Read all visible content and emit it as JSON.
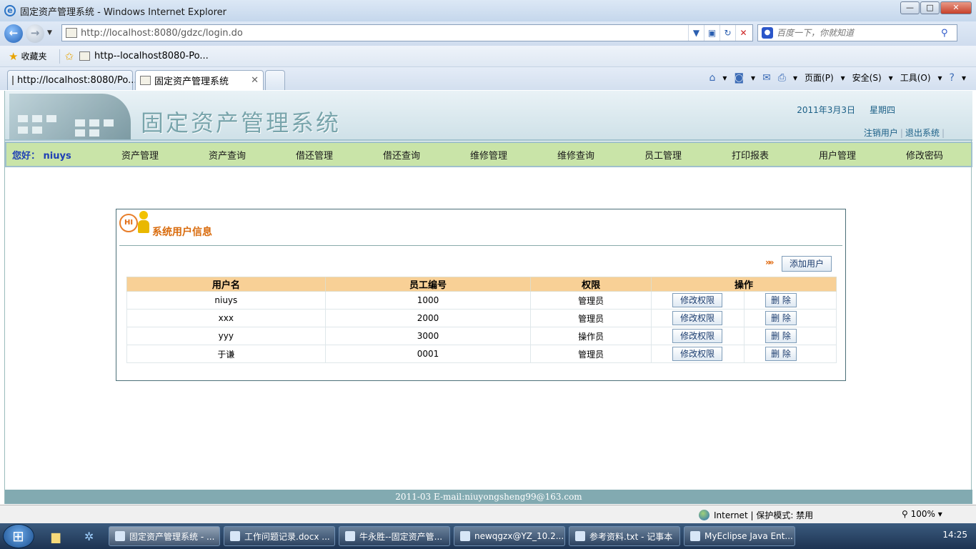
{
  "window": {
    "title": "固定资产管理系统 - Windows Internet Explorer",
    "controls": {
      "minimize": "—",
      "maximize": "□",
      "close": "✕"
    }
  },
  "address": {
    "url": "http://localhost:8080/gdzc/login.do",
    "search_placeholder": "百度一下，你就知道"
  },
  "favorites": {
    "label": "收藏夹",
    "link": "http--localhost8080-Po..."
  },
  "tabs": [
    {
      "label": "http://localhost:8080/Po..."
    },
    {
      "label": "固定资产管理系统",
      "close": "✕"
    }
  ],
  "command_bar": {
    "page": "页面(P)",
    "safety": "安全(S)",
    "tools": "工具(O)"
  },
  "banner": {
    "title": "固定资产管理系统",
    "date": "2011年3月3日",
    "weekday": "星期四",
    "logout_user": "注销用户",
    "exit_system": "退出系统"
  },
  "menu": {
    "greeting": "您好：  niuys",
    "items": [
      "资产管理",
      "资产查询",
      "借还管理",
      "借还查询",
      "维修管理",
      "维修查询",
      "员工管理",
      "打印报表",
      "用户管理",
      "修改密码"
    ]
  },
  "panel": {
    "hi_badge": "HI",
    "title": "系统用户信息",
    "add_user_label": "添加用户",
    "arrows": "»»"
  },
  "table": {
    "headers": [
      "用户名",
      "员工编号",
      "权限",
      "操作"
    ],
    "modify_label": "修改权限",
    "delete_label": "删  除",
    "rows": [
      {
        "username": "niuys",
        "employee_no": "1000",
        "role": "管理员"
      },
      {
        "username": "xxx",
        "employee_no": "2000",
        "role": "管理员"
      },
      {
        "username": "yyy",
        "employee_no": "3000",
        "role": "操作员"
      },
      {
        "username": "于谦",
        "employee_no": "0001",
        "role": "管理员"
      }
    ]
  },
  "footer": {
    "text": "2011-03 E-mail:niuyongsheng99@163.com"
  },
  "status": {
    "zone": "Internet | 保护模式: 禁用",
    "zoom": "100%"
  },
  "taskbar": {
    "items": [
      {
        "label": "固定资产管理系统 - ..."
      },
      {
        "label": "工作问题记录.docx ..."
      },
      {
        "label": "牛永胜--固定资产管..."
      },
      {
        "label": "newqgzx@YZ_10.2...."
      },
      {
        "label": "参考资料.txt - 记事本"
      },
      {
        "label": "MyEclipse Java Ent..."
      }
    ],
    "clock": "14:25"
  }
}
